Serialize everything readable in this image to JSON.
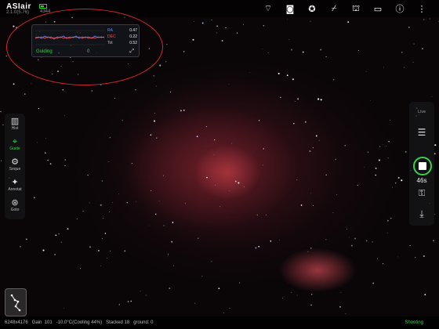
{
  "app": {
    "logo": "ASIair",
    "subinfo": "2.1.0(5.76)",
    "battery_text": "4344"
  },
  "top_icons": [
    {
      "name": "wifi-icon",
      "glyph": "⌔"
    },
    {
      "name": "camera-icon",
      "glyph": "◙"
    },
    {
      "name": "filter-wheel-icon",
      "glyph": "✪"
    },
    {
      "name": "telescope-icon",
      "glyph": "⌿"
    },
    {
      "name": "observatory-icon",
      "glyph": "⛫"
    },
    {
      "name": "display-icon",
      "glyph": "▭"
    },
    {
      "name": "info-icon",
      "glyph": "ⓘ"
    },
    {
      "name": "menu-icon",
      "glyph": "⋮"
    }
  ],
  "guide_panel": {
    "ra_label": "RA",
    "ra_value": "0.47",
    "dec_label": "DEC",
    "dec_value": "0.22",
    "tot_label": "Tot",
    "tot_value": "0.52",
    "status": "Guiding",
    "mid": "0"
  },
  "left_toolbar": [
    {
      "name": "histogram",
      "glyph": "▥",
      "label": "Hist",
      "active": false
    },
    {
      "name": "guide",
      "glyph": "⌖",
      "label": "Guide",
      "active": true
    },
    {
      "name": "sequence",
      "glyph": "⚙",
      "label": "Seque",
      "active": false
    },
    {
      "name": "annotate",
      "glyph": "✦",
      "label": "Annotat",
      "active": false
    },
    {
      "name": "goto",
      "glyph": "⊛",
      "label": "Goto",
      "active": false
    }
  ],
  "right_toolbar": {
    "top_label": "Live",
    "list_glyph": "☰",
    "exposure": "46s",
    "sub_glyph": "⚿",
    "download_glyph": "⤓"
  },
  "status_bar": {
    "left": "6248x4176   Gain  101   -10.0°C(Cooling 44%)   Stacked 18   ground: 0",
    "right": "Shooting"
  }
}
